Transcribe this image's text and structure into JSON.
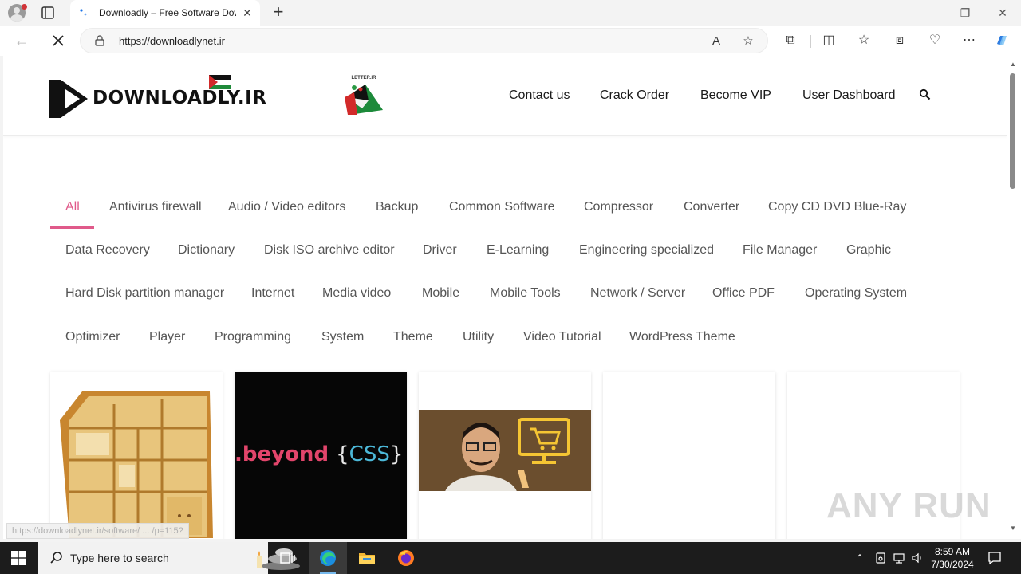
{
  "browser": {
    "tab_title": "Downloadly – Free Software Dow",
    "tab_close": "✕",
    "new_tab": "+",
    "url": "https://downloadlynet.ir",
    "window_controls": {
      "minimize": "—",
      "restore": "❐",
      "close": "✕"
    }
  },
  "site": {
    "logo_text": "DOWNLOADLY.IR",
    "badge_text": "LETTER.IR",
    "nav": [
      "Contact us",
      "Crack Order",
      "Become VIP",
      "User Dashboard"
    ],
    "accent_color": "#e05a8a"
  },
  "categories": [
    "All",
    "Antivirus firewall",
    "Audio / Video editors",
    "Backup",
    "Common Software",
    "Compressor",
    "Converter",
    "Copy CD DVD Blue-Ray",
    "Data Recovery",
    "Dictionary",
    "Disk ISO archive editor",
    "Driver",
    "E-Learning",
    "Engineering specialized",
    "File Manager",
    "Graphic",
    "Hard Disk partition manager",
    "Internet",
    "Media video",
    "Mobile",
    "Mobile Tools",
    "Network / Server",
    "Office PDF",
    "Operating System",
    "Optimizer",
    "Player",
    "Programming",
    "System",
    "Theme",
    "Utility",
    "Video Tutorial",
    "WordPress Theme"
  ],
  "active_category": "All",
  "cards": {
    "beyond_css": {
      "prefix": ".beyond",
      "open": "{",
      "word": "CSS",
      "close": "}"
    }
  },
  "statusbar": "https://downloadlynet.ir/software/ ... /p=115?",
  "watermark": "ANY RUN",
  "taskbar": {
    "search_placeholder": "Type here to search",
    "time": "8:59 AM",
    "date": "7/30/2024"
  }
}
